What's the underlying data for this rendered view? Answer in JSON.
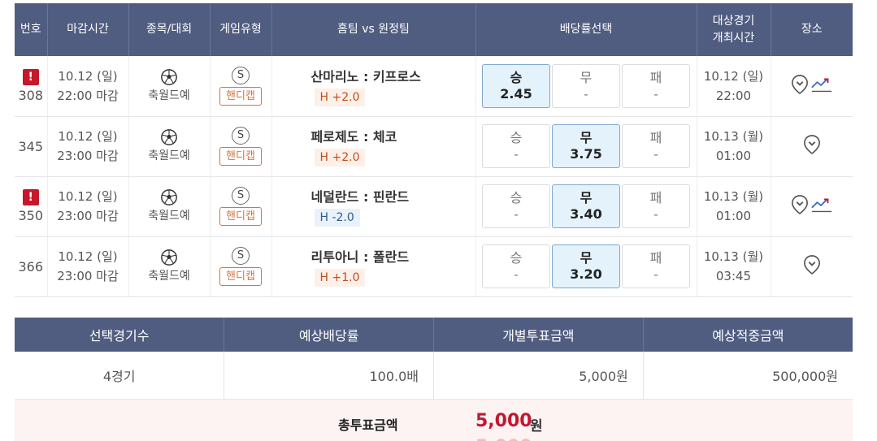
{
  "headers": {
    "no": "번호",
    "deadline": "마감시간",
    "sport": "종목/대회",
    "game_type": "게임유형",
    "teams": "홈팀 vs 원정팀",
    "odds": "배당률선택",
    "match_date_line1": "대상경기",
    "match_date_line2": "개최시간",
    "venue": "장소"
  },
  "rows": [
    {
      "alert": "!",
      "no": "308",
      "deadline_date": "10.12 (일)",
      "deadline_time": "22:00 마감",
      "sport": "축월드예",
      "type_badge": "S",
      "type_label": "핸디캡",
      "teams": "산마리노 : 키프로스",
      "handicap": "H +2.0",
      "handicap_sign": "plus",
      "odds": [
        {
          "label": "승",
          "value": "2.45",
          "selected": true
        },
        {
          "label": "무",
          "value": "-",
          "selected": false
        },
        {
          "label": "패",
          "value": "-",
          "selected": false
        }
      ],
      "match_date": "10.12 (일)",
      "match_time": "22:00",
      "has_trend": true
    },
    {
      "alert": "",
      "no": "345",
      "deadline_date": "10.12 (일)",
      "deadline_time": "23:00 마감",
      "sport": "축월드예",
      "type_badge": "S",
      "type_label": "핸디캡",
      "teams": "페로제도 : 체코",
      "handicap": "H +2.0",
      "handicap_sign": "plus",
      "odds": [
        {
          "label": "승",
          "value": "-",
          "selected": false
        },
        {
          "label": "무",
          "value": "3.75",
          "selected": true
        },
        {
          "label": "패",
          "value": "-",
          "selected": false
        }
      ],
      "match_date": "10.13 (월)",
      "match_time": "01:00",
      "has_trend": false
    },
    {
      "alert": "!",
      "no": "350",
      "deadline_date": "10.12 (일)",
      "deadline_time": "23:00 마감",
      "sport": "축월드예",
      "type_badge": "S",
      "type_label": "핸디캡",
      "teams": "네덜란드 : 핀란드",
      "handicap": "H -2.0",
      "handicap_sign": "minus",
      "odds": [
        {
          "label": "승",
          "value": "-",
          "selected": false
        },
        {
          "label": "무",
          "value": "3.40",
          "selected": true
        },
        {
          "label": "패",
          "value": "-",
          "selected": false
        }
      ],
      "match_date": "10.13 (월)",
      "match_time": "01:00",
      "has_trend": true
    },
    {
      "alert": "",
      "no": "366",
      "deadline_date": "10.12 (일)",
      "deadline_time": "23:00 마감",
      "sport": "축월드예",
      "type_badge": "S",
      "type_label": "핸디캡",
      "teams": "리투아니 : 폴란드",
      "handicap": "H +1.0",
      "handicap_sign": "plus",
      "odds": [
        {
          "label": "승",
          "value": "-",
          "selected": false
        },
        {
          "label": "무",
          "value": "3.20",
          "selected": true
        },
        {
          "label": "패",
          "value": "-",
          "selected": false
        }
      ],
      "match_date": "10.13 (월)",
      "match_time": "03:45",
      "has_trend": false
    }
  ],
  "summary": {
    "headers": [
      "선택경기수",
      "예상배당률",
      "개별투표금액",
      "예상적중금액"
    ],
    "values": [
      "4경기",
      "100.0배",
      "5,000원",
      "500,000원"
    ]
  },
  "total": {
    "label": "총투표금액",
    "amount": "5,000",
    "unit": "원"
  },
  "colors": {
    "header_bg": "#505d80",
    "alert_red": "#c7172b",
    "handicap_orange": "#d2763f",
    "selected_bg": "#e3f2fb",
    "total_red": "#c2182f"
  }
}
